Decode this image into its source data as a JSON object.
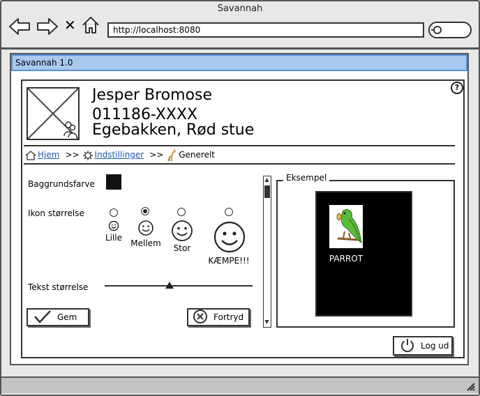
{
  "browser": {
    "title": "Savannah",
    "url": "http://localhost:8080",
    "icons": [
      "back-arrow-icon",
      "forward-arrow-icon",
      "stop-icon",
      "home-icon",
      "search-icon"
    ]
  },
  "app": {
    "title": "Savannah 1.0"
  },
  "help": {
    "label": "?"
  },
  "user": {
    "name": "Jesper Bromose",
    "id": "011186-XXXX",
    "location": "Egebakken, Rød stue"
  },
  "breadcrumb": {
    "home": "Hjem",
    "separator": ">>",
    "settings": "Indstillinger",
    "current": "Generelt"
  },
  "settings": {
    "background_label": "Baggrundsfarve",
    "background_color": "#111111",
    "icon_size_label": "Ikon størrelse",
    "icon_sizes": [
      {
        "label": "Lille",
        "selected": false
      },
      {
        "label": "Mellem",
        "selected": true
      },
      {
        "label": "Stor",
        "selected": false
      },
      {
        "label": "KÆMPE!!!",
        "selected": false
      }
    ],
    "text_size_label": "Tekst størrelse",
    "text_size_fraction": 0.44
  },
  "buttons": {
    "save": "Gem",
    "cancel": "Fortryd",
    "logout": "Log ud"
  },
  "example": {
    "legend": "Eksempel",
    "item_label": "PARROT",
    "card_color": "#000000"
  }
}
